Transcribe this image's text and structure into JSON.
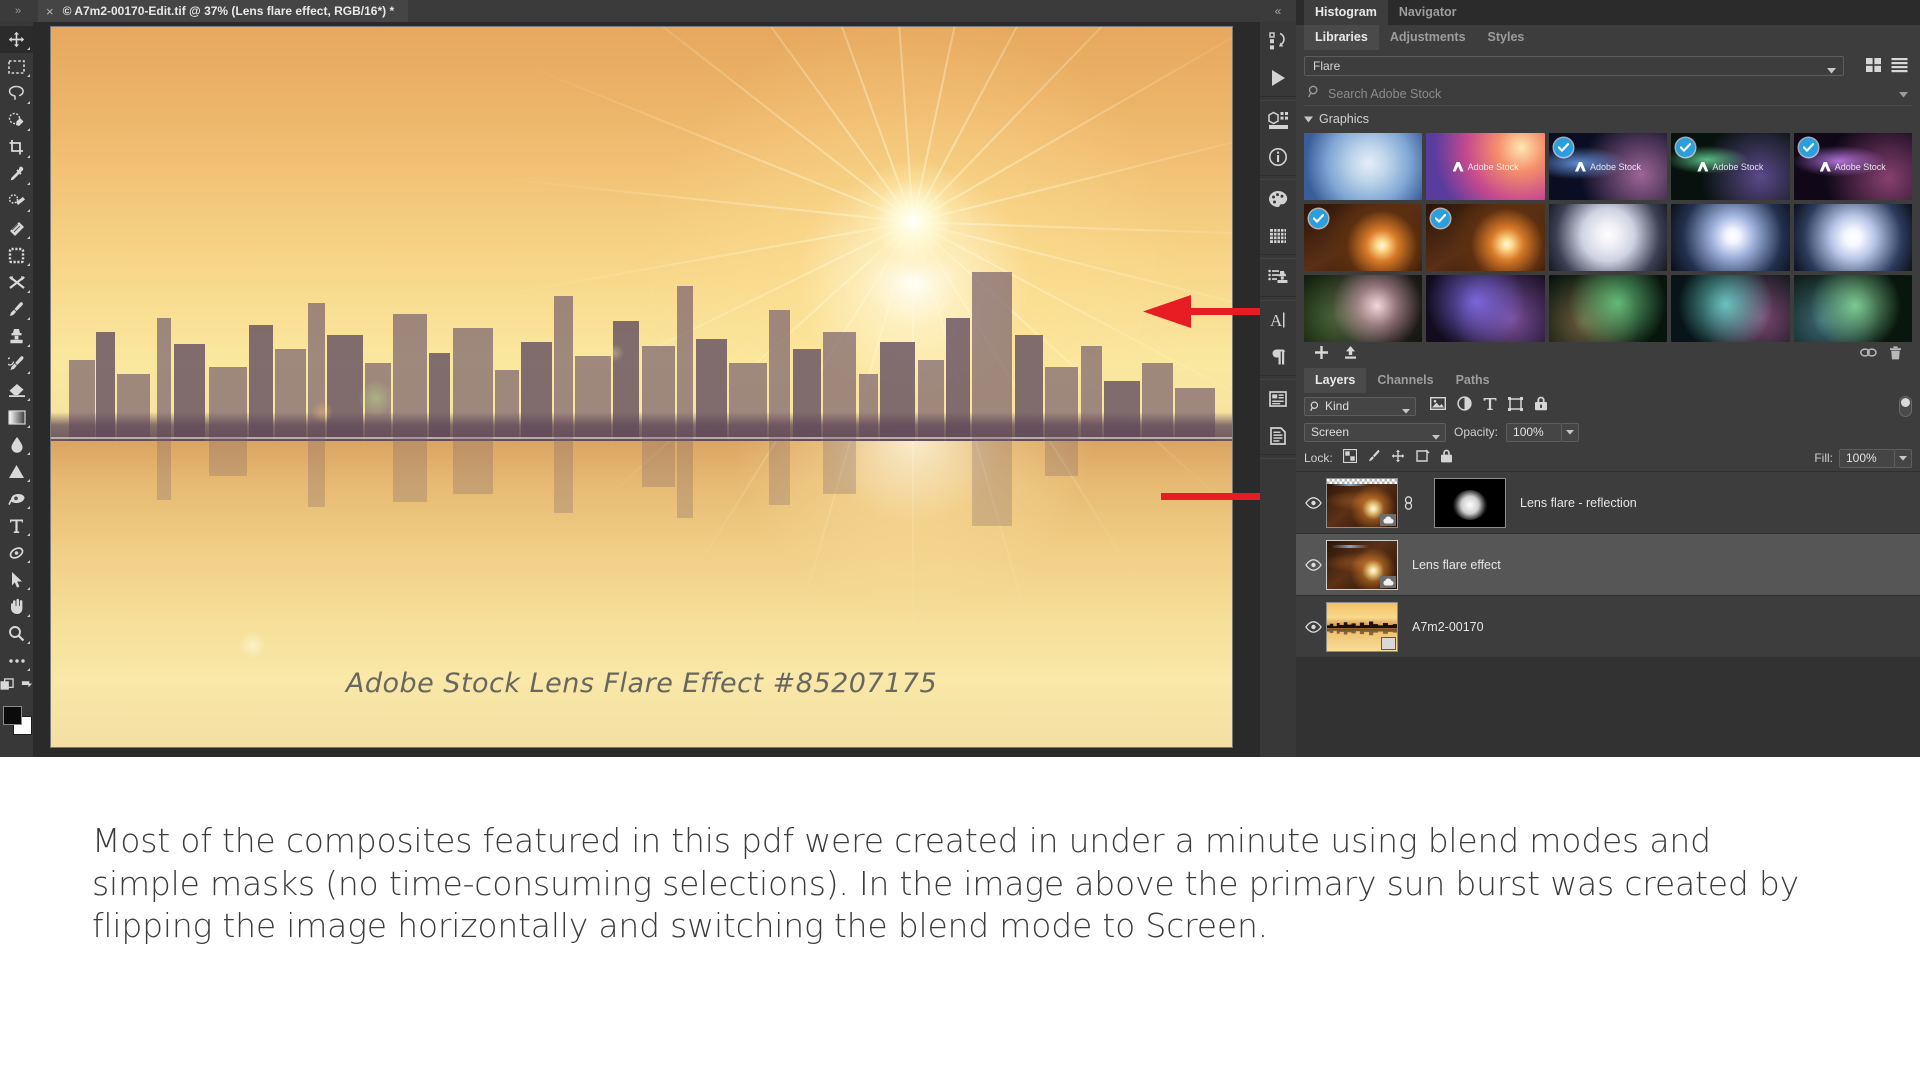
{
  "window": {
    "tab_close": "×",
    "document_title": "© A7m2-00170-Edit.tif @ 37% (Lens flare effect, RGB/16*) *",
    "collapse_glyph": "»"
  },
  "toolbar": {
    "tools": [
      {
        "name": "move-tool",
        "label": "Move Tool",
        "active": true
      },
      {
        "name": "marquee-tool",
        "label": "Rectangular Marquee Tool"
      },
      {
        "name": "lasso-tool",
        "label": "Lasso Tool"
      },
      {
        "name": "quick-selection-tool",
        "label": "Quick Selection Tool"
      },
      {
        "name": "crop-tool",
        "label": "Crop Tool"
      },
      {
        "name": "eyedropper-tool",
        "label": "Eyedropper Tool"
      },
      {
        "name": "spot-healing-brush-tool",
        "label": "Spot Healing Brush Tool"
      },
      {
        "name": "patch-tool",
        "label": "Patch Tool"
      },
      {
        "name": "frame-tool",
        "label": "Frame Tool"
      },
      {
        "name": "shuffle-tool",
        "label": "Content Aware Move Tool"
      },
      {
        "name": "brush-tool",
        "label": "Brush Tool"
      },
      {
        "name": "clone-stamp-tool",
        "label": "Clone Stamp Tool"
      },
      {
        "name": "history-brush-tool",
        "label": "History Brush Tool"
      },
      {
        "name": "eraser-tool",
        "label": "Eraser Tool"
      },
      {
        "name": "gradient-tool",
        "label": "Gradient Tool"
      },
      {
        "name": "blur-tool",
        "label": "Blur Tool"
      },
      {
        "name": "dodge-tool",
        "label": "Dodge Tool"
      },
      {
        "name": "pen-tool",
        "label": "Pen Tool"
      },
      {
        "name": "type-tool",
        "label": "Horizontal Type Tool"
      },
      {
        "name": "path-selection-tool",
        "label": "Path Selection Tool"
      },
      {
        "name": "direct-selection-tool",
        "label": "Direct Selection Tool"
      },
      {
        "name": "hand-tool",
        "label": "Hand Tool"
      },
      {
        "name": "zoom-tool",
        "label": "Zoom Tool"
      },
      {
        "name": "edit-toolbar-tool",
        "label": "Edit Toolbar"
      }
    ],
    "foreground_color": "#0b0b0b",
    "background_color": "#ffffff"
  },
  "canvas": {
    "watermark": "Adobe Stock Lens Flare Effect #85207175",
    "arrow_color": "#e81c23"
  },
  "dock": {
    "icons": [
      {
        "name": "history-icon",
        "label": "History"
      },
      {
        "name": "actions-icon",
        "label": "Actions"
      },
      {
        "name": "properties-icon",
        "label": "Properties"
      },
      {
        "name": "info-icon",
        "label": "Info"
      },
      {
        "name": "color-icon",
        "label": "Color"
      },
      {
        "name": "swatches-icon",
        "label": "Swatches"
      },
      {
        "name": "clone-source-icon",
        "label": "Clone Source"
      },
      {
        "name": "character-icon",
        "label": "Character"
      },
      {
        "name": "paragraph-icon",
        "label": "Paragraph"
      },
      {
        "name": "character-styles-icon",
        "label": "Character Styles"
      },
      {
        "name": "paragraph-styles-icon",
        "label": "Paragraph Styles"
      }
    ],
    "collapse_glyph": "«"
  },
  "libraries": {
    "tabs_row1": [
      {
        "label": "Histogram",
        "active": true
      },
      {
        "label": "Navigator",
        "active": false
      }
    ],
    "tabs_row2": [
      {
        "label": "Libraries",
        "active": true
      },
      {
        "label": "Adjustments",
        "active": false
      },
      {
        "label": "Styles",
        "active": false
      }
    ],
    "selected_library": "Flare",
    "search_placeholder": "Search Adobe Stock",
    "section_title": "Graphics",
    "thumbnails": [
      {
        "id": "g1",
        "checked": false,
        "stock_label": "",
        "style": "soft-blue"
      },
      {
        "id": "g2",
        "checked": false,
        "stock_label": "Adobe Stock",
        "style": "magenta-gradient"
      },
      {
        "id": "g3",
        "checked": true,
        "stock_label": "Adobe Stock",
        "style": "dark-blue-flare"
      },
      {
        "id": "g4",
        "checked": true,
        "stock_label": "Adobe Stock",
        "style": "green-flare"
      },
      {
        "id": "g5",
        "checked": true,
        "stock_label": "Adobe Stock",
        "style": "purple-flare"
      },
      {
        "id": "g6",
        "checked": true,
        "stock_label": "",
        "style": "orange-starburst"
      },
      {
        "id": "g7",
        "checked": true,
        "stock_label": "",
        "style": "orange-starburst-2"
      },
      {
        "id": "g8",
        "checked": false,
        "stock_label": "",
        "style": "white-glow"
      },
      {
        "id": "g9",
        "checked": false,
        "stock_label": "",
        "style": "white-star"
      },
      {
        "id": "g10",
        "checked": false,
        "stock_label": "",
        "style": "white-star-2"
      },
      {
        "id": "g11",
        "checked": false,
        "stock_label": "",
        "style": "bokeh-pink"
      },
      {
        "id": "g12",
        "checked": false,
        "stock_label": "",
        "style": "bokeh-blue"
      },
      {
        "id": "g13",
        "checked": false,
        "stock_label": "",
        "style": "bokeh-green"
      },
      {
        "id": "g14",
        "checked": false,
        "stock_label": "",
        "style": "bokeh-teal"
      },
      {
        "id": "g15",
        "checked": false,
        "stock_label": "",
        "style": "bokeh-green2"
      }
    ],
    "footer": {
      "add_label": "+",
      "upload_label": "↑",
      "link_label": "link",
      "delete_label": "delete"
    }
  },
  "layers": {
    "tabs": [
      {
        "label": "Layers",
        "active": true
      },
      {
        "label": "Channels",
        "active": false
      },
      {
        "label": "Paths",
        "active": false
      }
    ],
    "filter_kind": "Kind",
    "filter_icons": [
      "pixel-filter-icon",
      "adjustment-filter-icon",
      "type-filter-icon",
      "shape-filter-icon",
      "smartobject-filter-icon"
    ],
    "blend_mode": "Screen",
    "opacity_label": "Opacity:",
    "opacity_value": "100%",
    "lock_label": "Lock:",
    "lock_icons": [
      "lock-transparent-icon",
      "lock-image-icon",
      "lock-position-icon",
      "lock-artboard-icon",
      "lock-all-icon"
    ],
    "fill_label": "Fill:",
    "fill_value": "100%",
    "items": [
      {
        "name": "Lens flare - reflection",
        "visible": true,
        "selected": false,
        "has_mask": true,
        "linked": true,
        "kind": "flare"
      },
      {
        "name": "Lens flare effect",
        "visible": true,
        "selected": true,
        "has_mask": false,
        "linked": false,
        "kind": "flare"
      },
      {
        "name": "A7m2-00170",
        "visible": true,
        "selected": false,
        "has_mask": false,
        "linked": false,
        "kind": "city"
      }
    ]
  },
  "caption": {
    "text": "Most of the composites featured in this pdf were created in under a minute using blend modes and simple masks (no time-consuming selections). In the image above the primary sun burst was created by flipping the image horizontally and switching the blend mode to Screen."
  }
}
